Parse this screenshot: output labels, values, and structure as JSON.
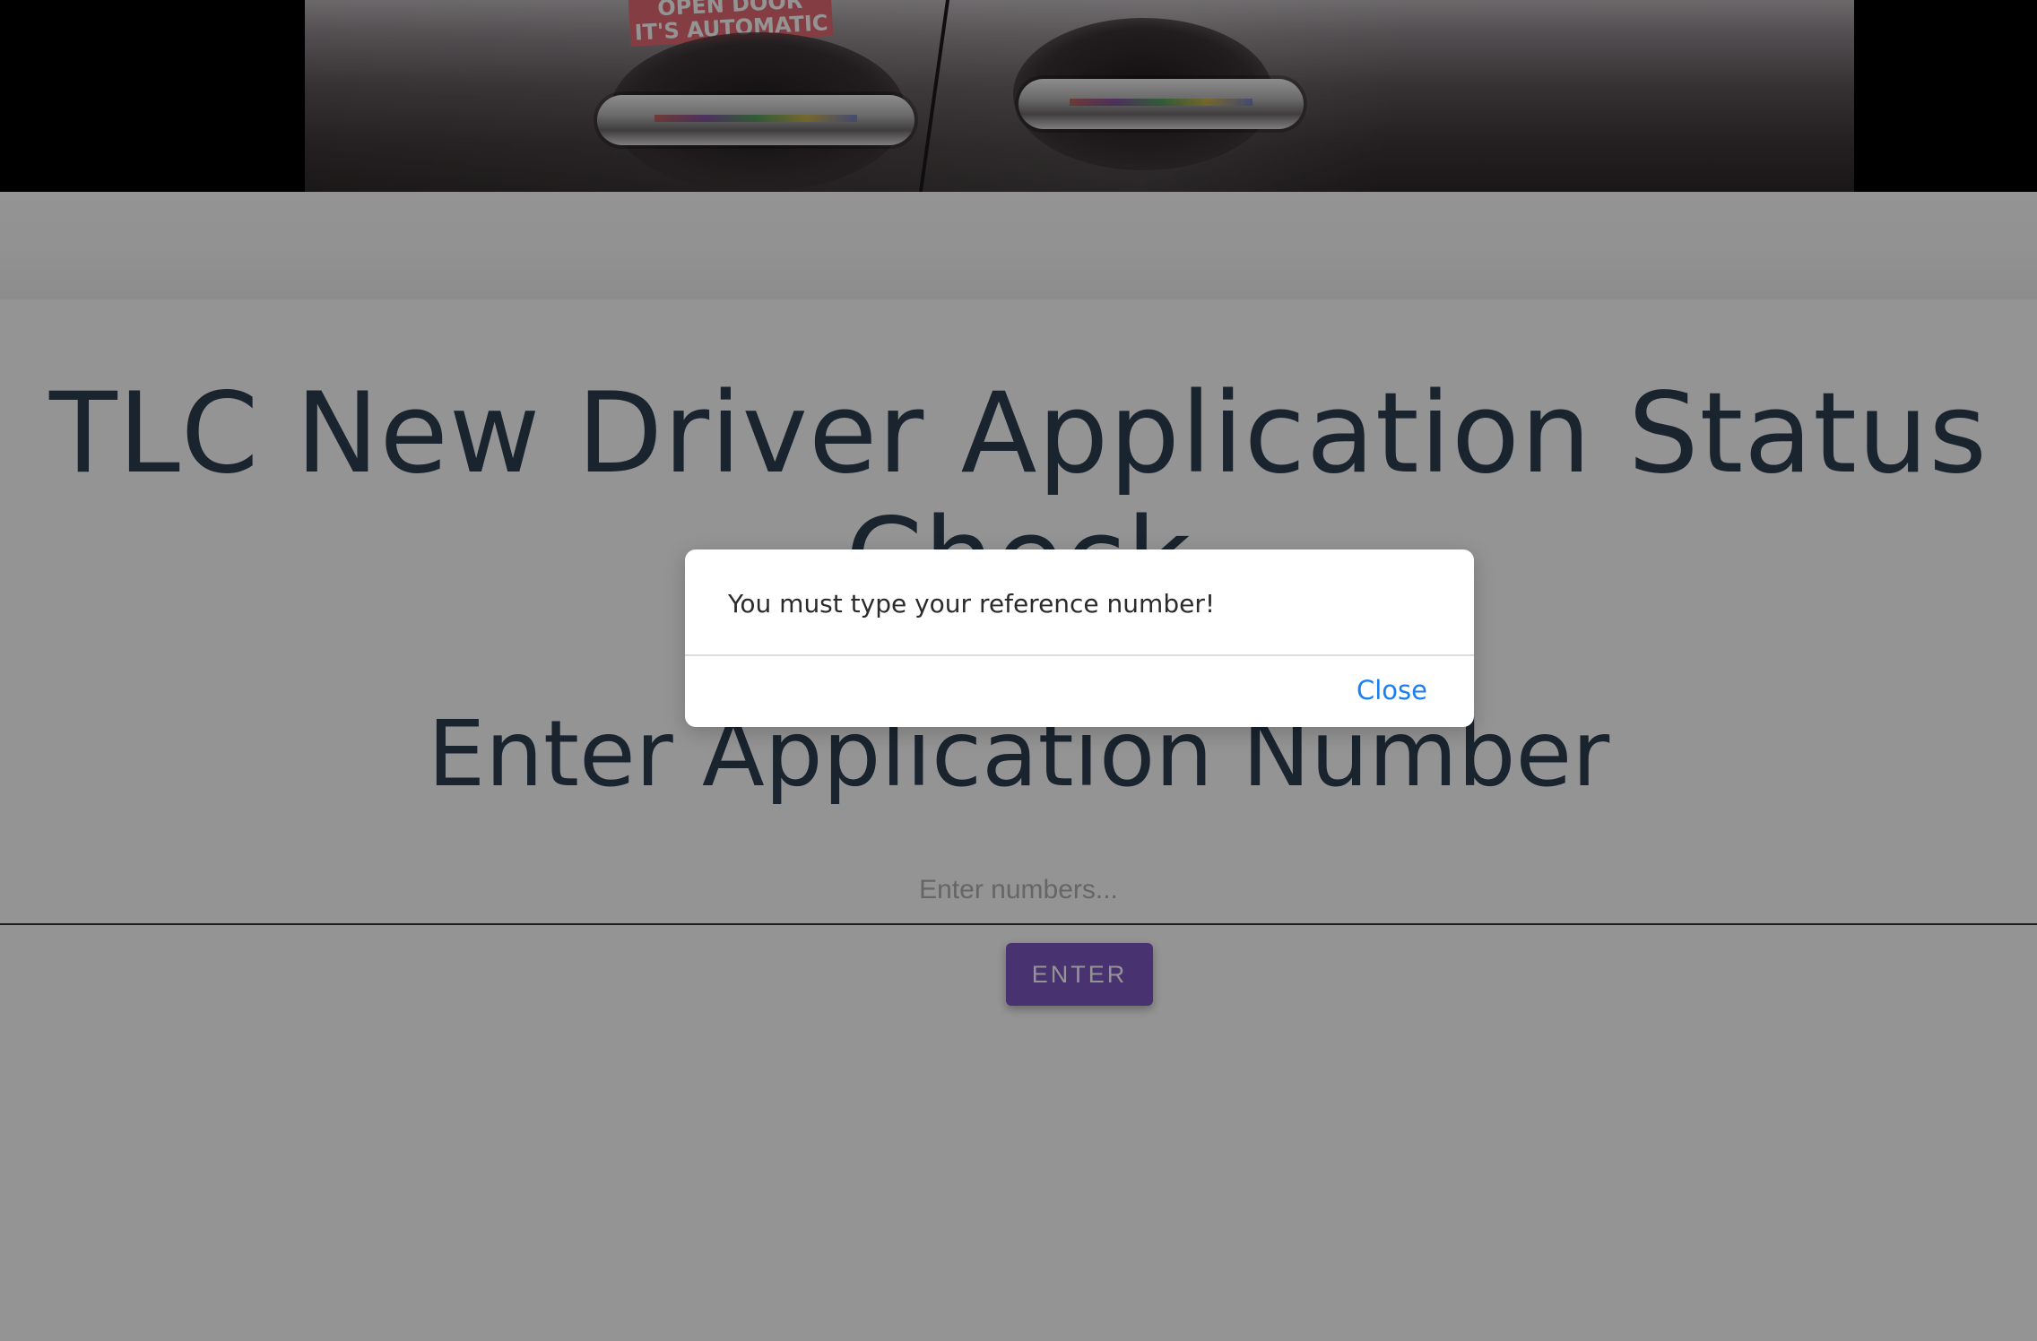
{
  "hero": {
    "sticker_lines": [
      "OPEN DOOR",
      "IT'S AUTOMATIC"
    ]
  },
  "main": {
    "title": "TLC New Driver Application Status Check",
    "section_title": "Enter Application Number",
    "input_placeholder": "Enter numbers...",
    "input_value": "",
    "enter_button_label": "ENTER"
  },
  "modal": {
    "message": "You must type your reference number!",
    "close_label": "Close"
  },
  "colors": {
    "title": "#2c3e50",
    "button": "#7e57c2",
    "link": "#1a7ff0",
    "overlay": "rgba(0,0,0,0.42)"
  }
}
